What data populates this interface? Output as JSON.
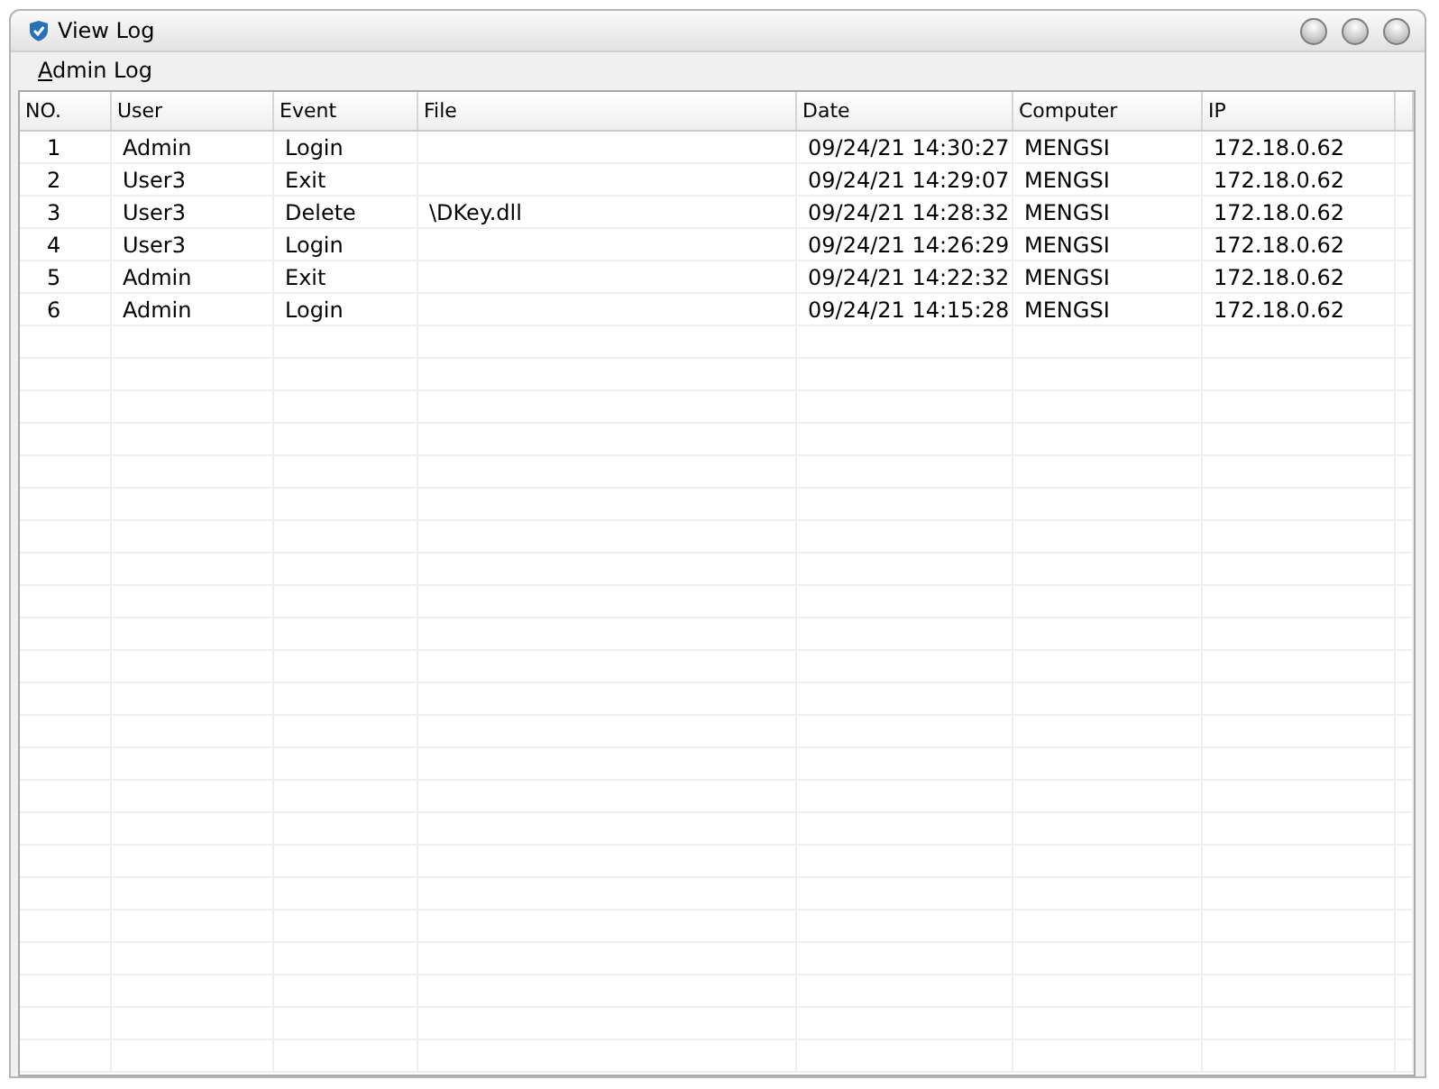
{
  "window": {
    "title": "View Log"
  },
  "menu": [
    "Admin Log"
  ],
  "table": {
    "columns": [
      "NO.",
      "User",
      "Event",
      "File",
      "Date",
      "Computer",
      "IP"
    ],
    "rows": [
      [
        "1",
        "Admin",
        "Login",
        "",
        "09/24/21 14:30:27",
        "MENGSI",
        "172.18.0.62"
      ],
      [
        "2",
        "User3",
        "Exit",
        "",
        "09/24/21 14:29:07",
        "MENGSI",
        "172.18.0.62"
      ],
      [
        "3",
        "User3",
        "Delete",
        "\\DKey.dll",
        "09/24/21 14:28:32",
        "MENGSI",
        "172.18.0.62"
      ],
      [
        "4",
        "User3",
        "Login",
        "",
        "09/24/21 14:26:29",
        "MENGSI",
        "172.18.0.62"
      ],
      [
        "5",
        "Admin",
        "Exit",
        "",
        "09/24/21 14:22:32",
        "MENGSI",
        "172.18.0.62"
      ],
      [
        "6",
        "Admin",
        "Login",
        "",
        "09/24/21 14:15:28",
        "MENGSI",
        "172.18.0.62"
      ]
    ]
  }
}
